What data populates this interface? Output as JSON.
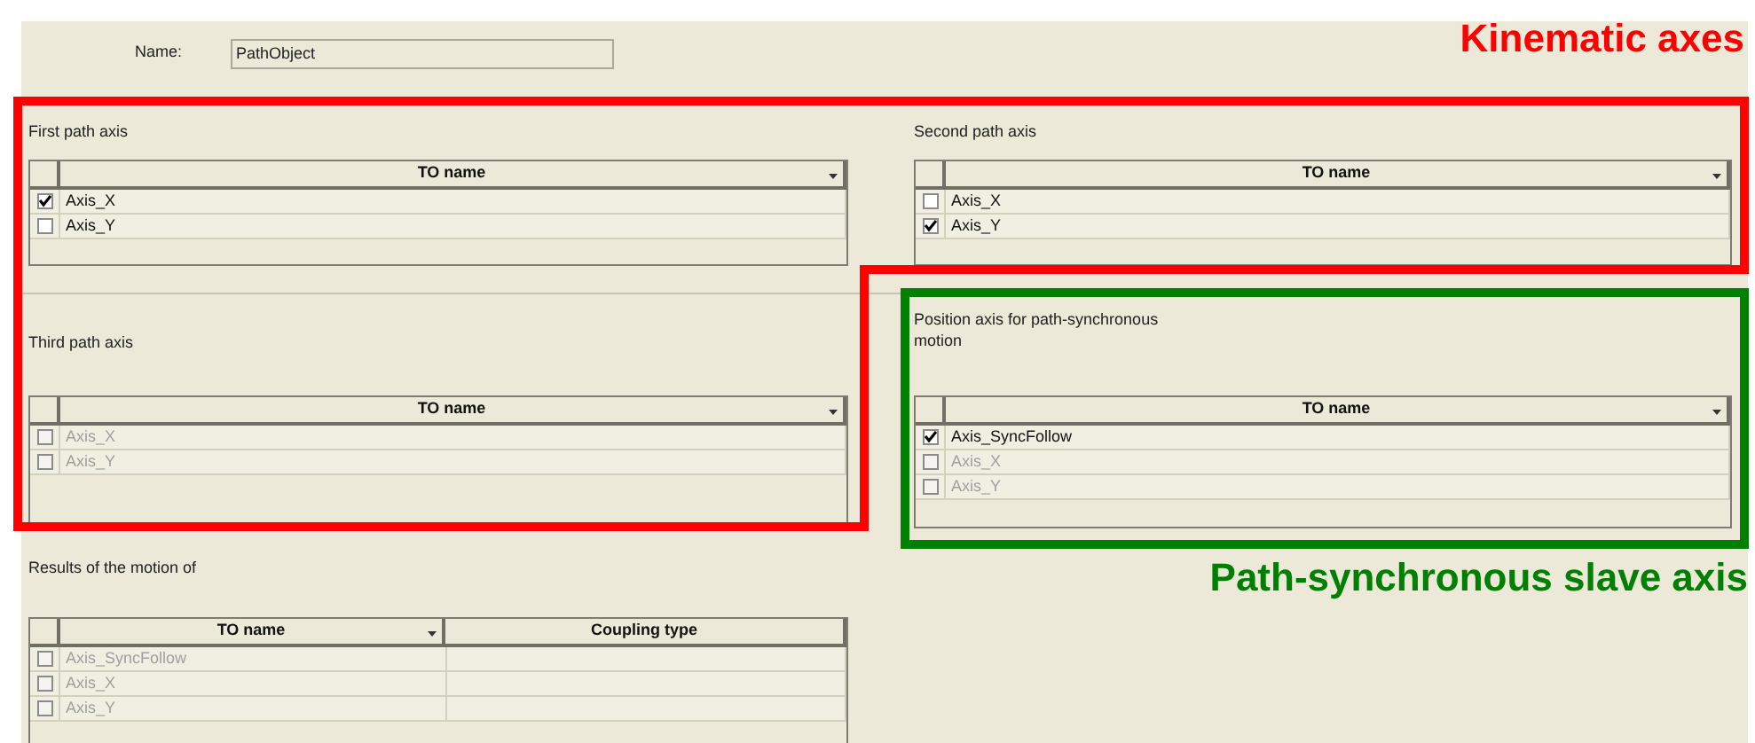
{
  "name_field": {
    "label": "Name:",
    "value": "PathObject"
  },
  "sections": [
    {
      "label": "First path axis",
      "columns": [
        {
          "title": "TO name",
          "dropdown": true
        }
      ],
      "rows": [
        {
          "cells": [
            "Axis_X"
          ],
          "checked": true,
          "disabled": false
        },
        {
          "cells": [
            "Axis_Y"
          ],
          "checked": false,
          "disabled": false
        }
      ]
    },
    {
      "label": "Third path axis",
      "columns": [
        {
          "title": "TO name",
          "dropdown": true
        }
      ],
      "rows": [
        {
          "cells": [
            "Axis_X"
          ],
          "checked": false,
          "disabled": true
        },
        {
          "cells": [
            "Axis_Y"
          ],
          "checked": false,
          "disabled": true
        }
      ]
    },
    {
      "label": "Results of the motion of",
      "columns": [
        {
          "title": "TO name",
          "dropdown": true
        },
        {
          "title": "Coupling type",
          "dropdown": false
        }
      ],
      "rows": [
        {
          "cells": [
            "Axis_SyncFollow"
          ],
          "checked": false,
          "disabled": true
        },
        {
          "cells": [
            "Axis_X"
          ],
          "checked": false,
          "disabled": true
        },
        {
          "cells": [
            "Axis_Y"
          ],
          "checked": false,
          "disabled": true
        }
      ]
    },
    {
      "label": "Second path axis",
      "columns": [
        {
          "title": "TO name",
          "dropdown": true
        }
      ],
      "rows": [
        {
          "cells": [
            "Axis_X"
          ],
          "checked": false,
          "disabled": false
        },
        {
          "cells": [
            "Axis_Y"
          ],
          "checked": true,
          "disabled": false
        }
      ]
    },
    {
      "label": "Position axis for path-synchronous motion",
      "columns": [
        {
          "title": "TO name",
          "dropdown": true
        }
      ],
      "rows": [
        {
          "cells": [
            "Axis_SyncFollow"
          ],
          "checked": true,
          "disabled": false
        },
        {
          "cells": [
            "Axis_X"
          ],
          "checked": false,
          "disabled": true
        },
        {
          "cells": [
            "Axis_Y"
          ],
          "checked": false,
          "disabled": true
        }
      ]
    }
  ],
  "annotations": [
    {
      "text": "Kinematic axes",
      "color": "#ff0000"
    },
    {
      "text": "Path-synchronous slave axis",
      "color": "#008000"
    }
  ]
}
